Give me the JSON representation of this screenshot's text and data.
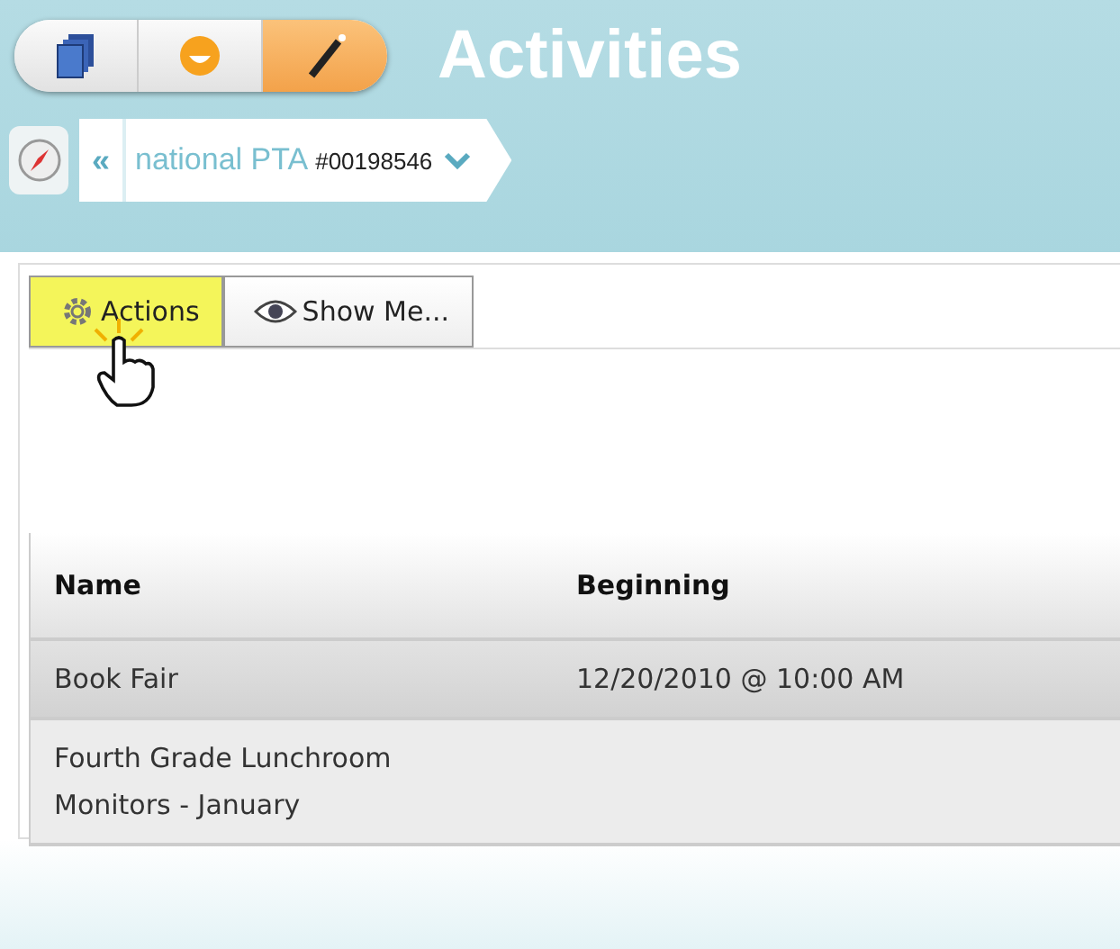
{
  "nav_tabs": [
    {
      "kind": "books",
      "selected": false
    },
    {
      "kind": "smiley",
      "selected": false
    },
    {
      "kind": "wand",
      "selected": true
    }
  ],
  "title": "Activities",
  "breadcrumb": {
    "back": "«",
    "name": "national PTA",
    "number": "#00198546"
  },
  "toolbar": [
    {
      "kind": "gear",
      "label": "Actions",
      "highlighted": true
    },
    {
      "kind": "eye",
      "label": "Show Me...",
      "highlighted": false
    }
  ],
  "table": {
    "columns": [
      "Name",
      "Beginning"
    ],
    "rows": [
      {
        "cells": [
          "Book Fair",
          "12/20/2010 @ 10:00 AM"
        ],
        "selected": true
      },
      {
        "cells": [
          "Fourth Grade Lunchroom Monitors - January",
          ""
        ],
        "selected": false
      }
    ]
  }
}
